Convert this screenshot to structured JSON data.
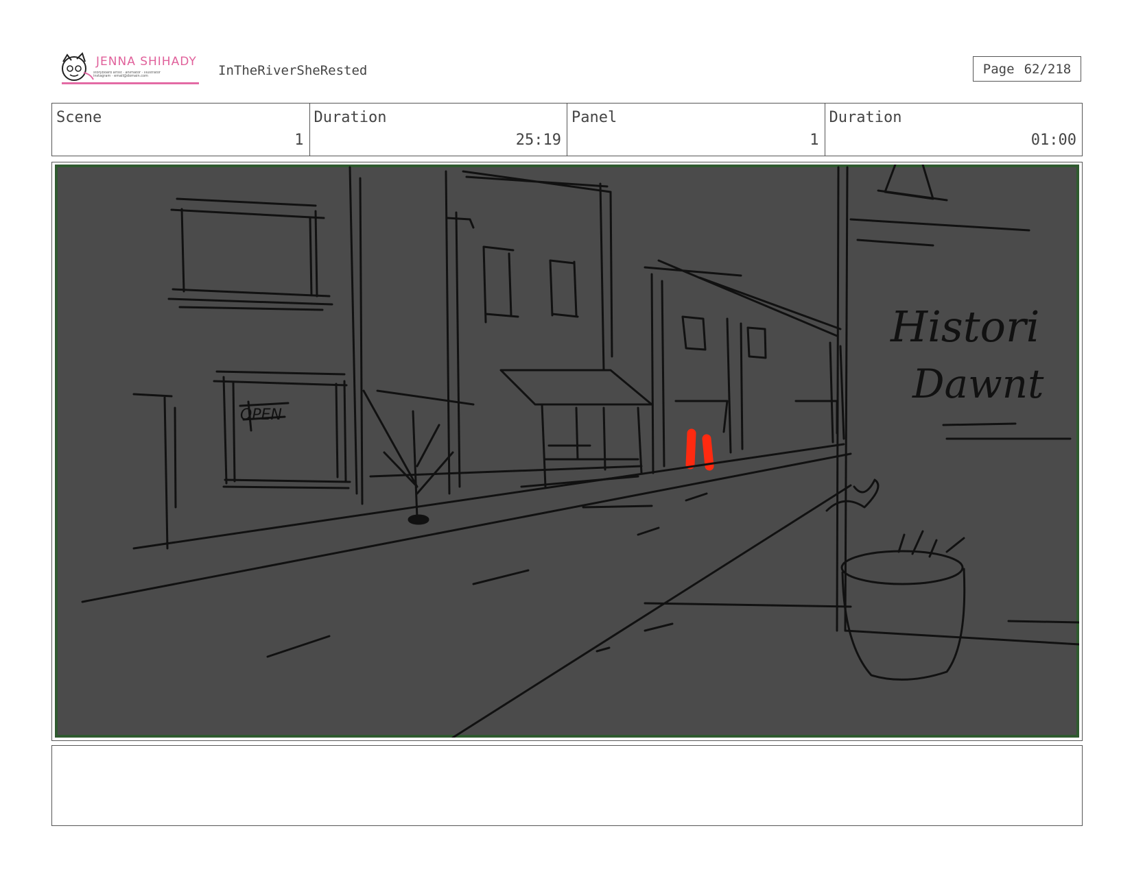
{
  "header": {
    "logo": {
      "name": "JENNA SHIHADY",
      "tagline": "storyboard artist · animator · illustrator",
      "contact": "instagram · email@domain.com"
    },
    "project_title": "InTheRiverSheRested",
    "page_label": "Page",
    "page_value": "62/218"
  },
  "info": {
    "scene_label": "Scene",
    "scene_value": "1",
    "scene_duration_label": "Duration",
    "scene_duration_value": "25:19",
    "panel_label": "Panel",
    "panel_value": "1",
    "panel_duration_label": "Duration",
    "panel_duration_value": "01:00"
  },
  "panel": {
    "sign_text_line1": "Histori",
    "sign_text_line2": "Dawnt",
    "window_sign_text": "OPEN",
    "background_color": "#4b4b4b",
    "border_color": "#2f5a2f",
    "figure_color": "#ff2a10"
  },
  "notes": {
    "text": ""
  }
}
